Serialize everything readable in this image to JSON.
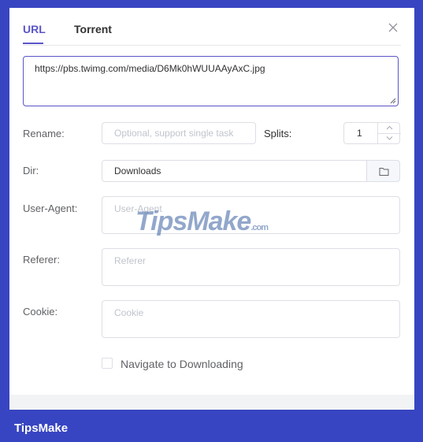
{
  "tabs": [
    {
      "label": "URL",
      "active": true
    },
    {
      "label": "Torrent",
      "active": false
    }
  ],
  "url_field": {
    "value": "https://pbs.twimg.com/media/D6Mk0hWUUAAyAxC.jpg"
  },
  "rename": {
    "label": "Rename:",
    "placeholder": "Optional, support single task"
  },
  "splits": {
    "label": "Splits:",
    "value": "1"
  },
  "dir": {
    "label": "Dir:",
    "value": "Downloads",
    "icon": "folder-icon"
  },
  "user_agent": {
    "label": "User-Agent:",
    "placeholder": "User-Agent"
  },
  "referer": {
    "label": "Referer:",
    "placeholder": "Referer"
  },
  "cookie": {
    "label": "Cookie:",
    "placeholder": "Cookie"
  },
  "navigate": {
    "label": "Navigate to Downloading",
    "checked": false
  },
  "watermark": {
    "main": "TipsMake",
    "suffix": ".com"
  },
  "brand": "TipsMake",
  "colors": {
    "accent": "#5b55c8",
    "frame": "#3845c2",
    "border": "#dcdfe6"
  }
}
